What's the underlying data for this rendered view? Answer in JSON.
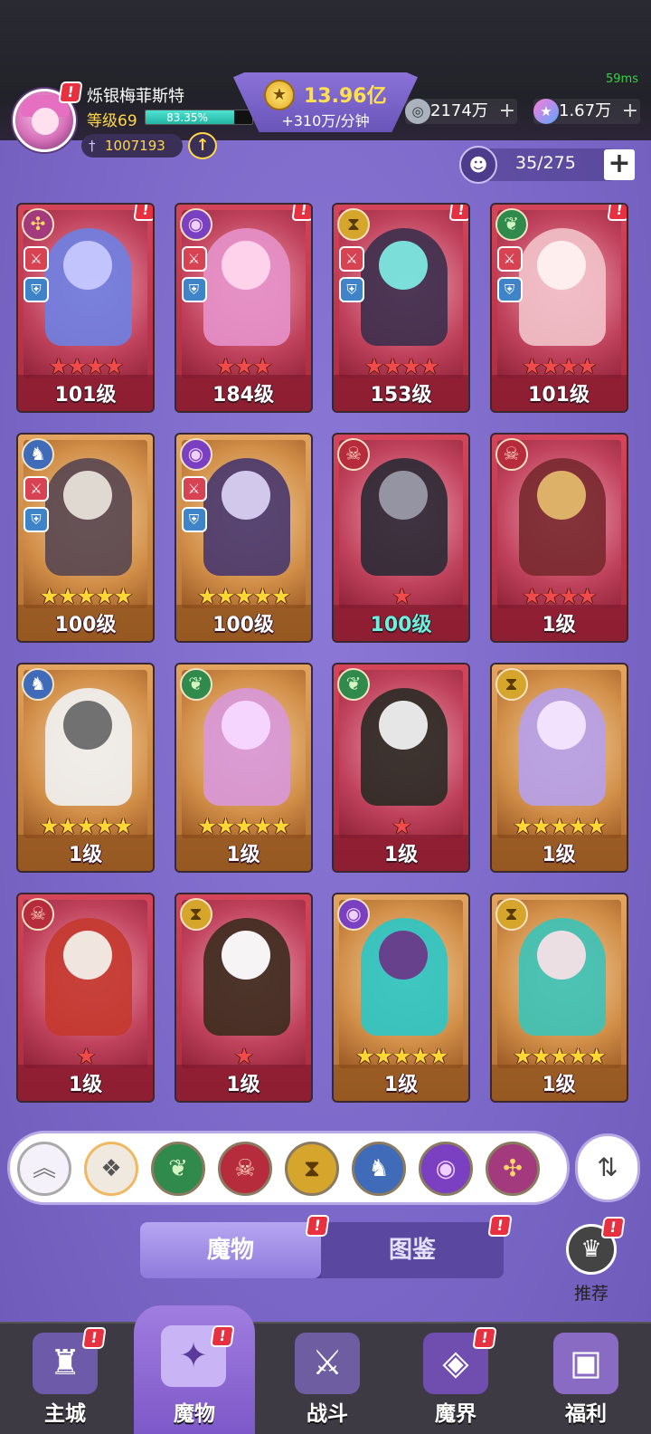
{
  "status": {
    "ping": "59ms"
  },
  "player": {
    "name": "烁银梅菲斯特",
    "level_label": "等级69",
    "xp_text": "83.35%",
    "xp_fraction": 0.8335,
    "power": "1007193"
  },
  "currency": {
    "gold": "13.96亿",
    "gold_rate": "+310万/分钟",
    "gems": "2174万",
    "gems_plus": "+",
    "stars": "1.67万",
    "stars_plus": "+"
  },
  "capacity": {
    "value": "35/275",
    "plus": "+"
  },
  "monsters": [
    {
      "level": "101级",
      "stars": 4,
      "rarity": "red",
      "element": "vortex",
      "alert": true
    },
    {
      "level": "184级",
      "stars": 3,
      "rarity": "red",
      "element": "eye",
      "alert": true
    },
    {
      "level": "153级",
      "stars": 4,
      "rarity": "red",
      "element": "hourglass",
      "alert": true
    },
    {
      "level": "101级",
      "stars": 4,
      "rarity": "red",
      "element": "leaf",
      "alert": true
    },
    {
      "level": "100级",
      "stars": 5,
      "rarity": "gold",
      "element": "dragon",
      "alert": false
    },
    {
      "level": "100级",
      "stars": 5,
      "rarity": "gold",
      "element": "eye",
      "alert": false
    },
    {
      "level": "100级",
      "stars": 1,
      "rarity": "red",
      "element": "skull",
      "alert": false,
      "teal": true
    },
    {
      "level": "1级",
      "stars": 4,
      "rarity": "red",
      "element": "skull",
      "alert": false
    },
    {
      "level": "1级",
      "stars": 5,
      "rarity": "gold",
      "element": "dragon",
      "alert": false
    },
    {
      "level": "1级",
      "stars": 5,
      "rarity": "gold",
      "element": "leaf",
      "alert": false
    },
    {
      "level": "1级",
      "stars": 1,
      "rarity": "red",
      "element": "leaf",
      "alert": false
    },
    {
      "level": "1级",
      "stars": 5,
      "rarity": "gold",
      "element": "hourglass",
      "alert": false
    },
    {
      "level": "1级",
      "stars": 1,
      "rarity": "red",
      "element": "skull",
      "alert": false
    },
    {
      "level": "1级",
      "stars": 1,
      "rarity": "red",
      "element": "hourglass",
      "alert": false
    },
    {
      "level": "1级",
      "stars": 5,
      "rarity": "gold",
      "element": "eye",
      "alert": false
    },
    {
      "level": "1级",
      "stars": 5,
      "rarity": "gold",
      "element": "hourglass",
      "alert": false
    }
  ],
  "filters": [
    "collapse",
    "all",
    "leaf",
    "skull",
    "hourglass",
    "dragon",
    "eye",
    "vortex"
  ],
  "tabs": {
    "monsters": "魔物",
    "codex": "图鉴"
  },
  "recommend": "推荐",
  "nav": [
    {
      "label": "主城",
      "icon": "castle-icon"
    },
    {
      "label": "魔物",
      "icon": "flame-icon"
    },
    {
      "label": "战斗",
      "icon": "sword-shield-icon"
    },
    {
      "label": "魔界",
      "icon": "portal-icon"
    },
    {
      "label": "福利",
      "icon": "chest-icon"
    }
  ]
}
